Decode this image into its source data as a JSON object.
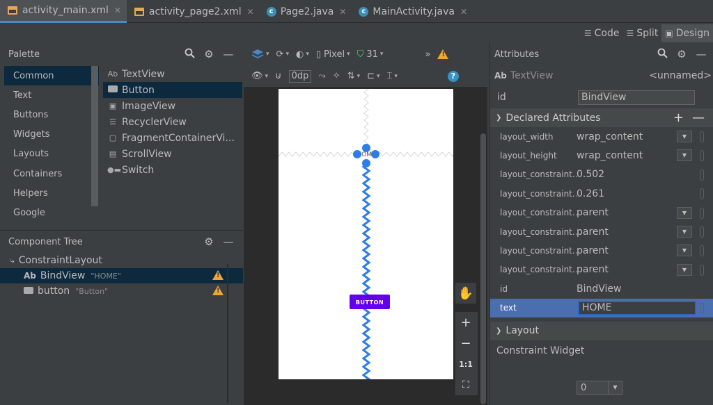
{
  "tabs": [
    {
      "label": "activity_main.xml",
      "icon": "xml-file-icon",
      "active": true
    },
    {
      "label": "activity_page2.xml",
      "icon": "xml-file-icon",
      "active": false
    },
    {
      "label": "Page2.java",
      "icon": "java-class-icon",
      "active": false
    },
    {
      "label": "MainActivity.java",
      "icon": "java-class-icon",
      "active": false
    }
  ],
  "view_modes": {
    "code": "Code",
    "split": "Split",
    "design": "Design"
  },
  "palette": {
    "title": "Palette",
    "categories": [
      "Common",
      "Text",
      "Buttons",
      "Widgets",
      "Layouts",
      "Containers",
      "Helpers",
      "Google"
    ],
    "widgets": [
      "TextView",
      "Button",
      "ImageView",
      "RecyclerView",
      "FragmentContainerVi...",
      "ScrollView",
      "Switch"
    ],
    "ab_glyph": "Ab"
  },
  "component_tree": {
    "title": "Component Tree",
    "root": "ConstraintLayout",
    "nodes": [
      {
        "prefix": "Ab",
        "name": "BindView",
        "sub": "\"HOME\""
      },
      {
        "prefix": "",
        "name": "button",
        "sub": "\"Button\""
      }
    ]
  },
  "canvas_toolbar": {
    "device": "Pixel",
    "api": "31",
    "margin": "0dp",
    "more": "»",
    "help": "?"
  },
  "device_preview": {
    "button_text": "BUTTON",
    "textview_text": "HOME",
    "button_color": "#6200ee",
    "handle_color": "#2d7ce8",
    "hbias": 0.502,
    "vbias": 0.261
  },
  "zoom": {
    "plus": "+",
    "minus": "−",
    "one_to_one": "1:1"
  },
  "attributes": {
    "title": "Attributes",
    "widget_type": "TextView",
    "widget_prefix": "Ab",
    "unnamed": "<unnamed>",
    "id_label": "id",
    "id_value": "BindView",
    "declared_title": "Declared Attributes",
    "declared": [
      {
        "name": "layout_width",
        "value": "wrap_content",
        "dropdown": true
      },
      {
        "name": "layout_height",
        "value": "wrap_content",
        "dropdown": true
      },
      {
        "name": "layout_constraint...",
        "value": "0.502",
        "dropdown": false
      },
      {
        "name": "layout_constraint...",
        "value": "0.261",
        "dropdown": false
      },
      {
        "name": "layout_constraint...",
        "value": "parent",
        "dropdown": true
      },
      {
        "name": "layout_constraint...",
        "value": "parent",
        "dropdown": true
      },
      {
        "name": "layout_constraint...",
        "value": "parent",
        "dropdown": true
      },
      {
        "name": "layout_constraint...",
        "value": "parent",
        "dropdown": true
      },
      {
        "name": "id",
        "value": "BindView",
        "dropdown": false
      },
      {
        "name": "text",
        "value": "HOME",
        "dropdown": false
      }
    ],
    "layout_title": "Layout",
    "constraint_widget": "Constraint Widget",
    "margin_value": "0"
  },
  "colors": {
    "accent": "#4a88c7",
    "selection": "#0d293e",
    "warning": "#f0a732",
    "attr_selected": "#4b6eaf"
  }
}
